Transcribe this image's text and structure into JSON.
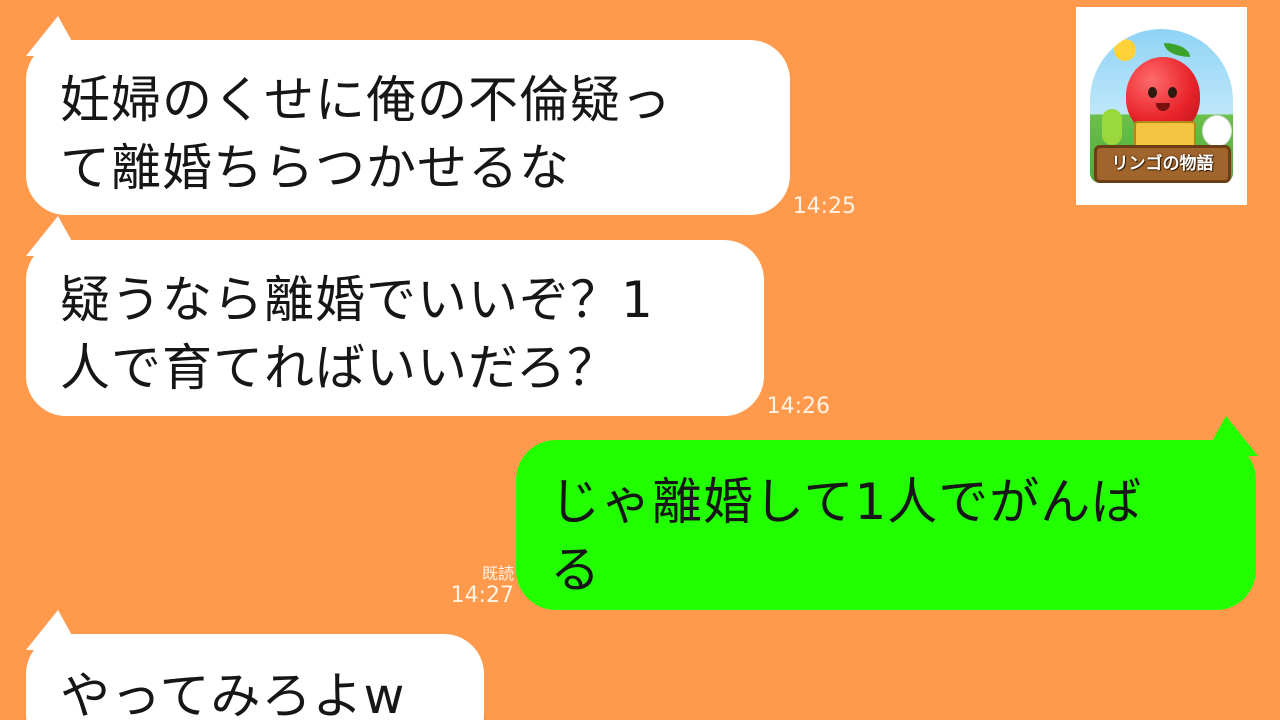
{
  "channel_logo": {
    "title": "リンゴの物語",
    "icon": "apple-character-reading-icon"
  },
  "colors": {
    "background": "#ff9a4d",
    "incoming_bubble": "#ffffff",
    "outgoing_bubble": "#22ff00",
    "timestamp": "#fff3e6"
  },
  "messages": [
    {
      "direction": "incoming",
      "line1": "妊婦のくせに俺の不倫疑っ",
      "line2": "て離婚ちらつかせるな",
      "time": "14:25"
    },
    {
      "direction": "incoming",
      "line1": "疑うなら離婚でいいぞ？1",
      "line2": "人で育てればいいだろ？",
      "time": "14:26"
    },
    {
      "direction": "outgoing",
      "line1": "じゃ離婚して1人でがんば",
      "line2": "る",
      "read_label": "既読",
      "time": "14:27"
    },
    {
      "direction": "incoming",
      "line1": "やってみろよw"
    }
  ]
}
